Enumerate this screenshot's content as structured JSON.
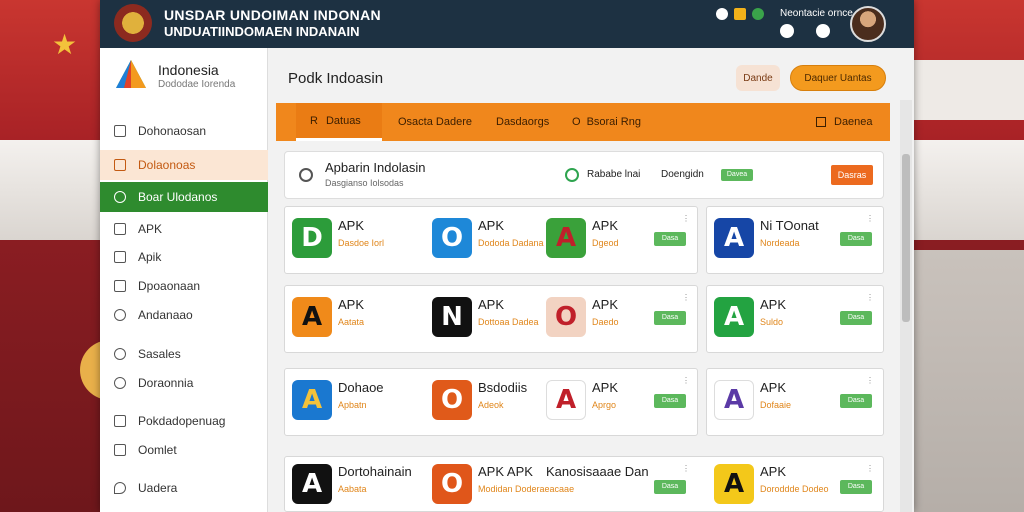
{
  "topbar": {
    "title_line1": "UNSDAR UNDOIMAN INDONAN",
    "title_line2": "UNDUATIINDOMAEN INDANAIN",
    "meta": "Neontacie ornce",
    "icon_names": [
      "record-icon",
      "folder-icon",
      "globe-icon",
      "chat-icon",
      "message-icon"
    ]
  },
  "sidebar": {
    "brand_name": "Indonesia",
    "brand_sub": "Dododae Iorenda",
    "items": [
      {
        "label": "Dohonaosan",
        "icon": "list-icon"
      },
      {
        "label": "Dolaonoas",
        "icon": "flag-icon"
      },
      {
        "label": "Boar Ulodanos",
        "icon": "leaf-icon"
      },
      {
        "label": "APK",
        "icon": "box-icon"
      },
      {
        "label": "Apik",
        "icon": "grid-icon"
      },
      {
        "label": "Dpoaonaan",
        "icon": "doc-icon"
      },
      {
        "label": "Andanaao",
        "icon": "user-icon"
      },
      {
        "label": "Sasales",
        "icon": "gear-icon"
      },
      {
        "label": "Doraonnia",
        "icon": "globe-icon"
      },
      {
        "label": "Pokdadopenuag",
        "icon": "edit-icon"
      },
      {
        "label": "Oomlet",
        "icon": "folder-icon"
      },
      {
        "label": "Uadera",
        "icon": "shield-icon"
      }
    ]
  },
  "main": {
    "page_title": "Podk Indoasin",
    "login_label": "Dande",
    "primary_label": "Daquer Uantas"
  },
  "tabs": [
    {
      "label": "Datuas",
      "prefix": "R"
    },
    {
      "label": "Osacta Dadere",
      "prefix": ""
    },
    {
      "label": "Dasdaorgs",
      "prefix": ""
    },
    {
      "label": "Bsorai Rng",
      "prefix": "O"
    },
    {
      "label": "Daenea",
      "prefix": ""
    }
  ],
  "search": {
    "title": "Apbarin Indolasin",
    "subtitle": "Dasgianso Iolsodas",
    "label1": "Rababe lnai",
    "label2": "Doengidn",
    "tag": "Davea",
    "button": "Dasras"
  },
  "apps": [
    {
      "name": "APK",
      "sub": "Dasdoe Iorl",
      "glyph": "D",
      "bg": "#2c9c3a",
      "fg": "#ffffff"
    },
    {
      "name": "APK",
      "sub": "Dododa Dadana",
      "glyph": "O",
      "bg": "#1e88d8",
      "fg": "#ffffff"
    },
    {
      "name": "APK",
      "sub": "Dgeod",
      "glyph": "A",
      "bg": "#3aa13a",
      "fg": "#c0202a"
    },
    {
      "name": "Ni TOonat",
      "sub": "Nordeada",
      "glyph": "A",
      "bg": "#1646a6",
      "fg": "#ffffff"
    },
    {
      "name": "APK",
      "sub": "Aatata",
      "glyph": "A",
      "bg": "#f08a1a",
      "fg": "#111111"
    },
    {
      "name": "APK",
      "sub": "Dottoaa Dadea",
      "glyph": "N",
      "bg": "#111111",
      "fg": "#ffffff"
    },
    {
      "name": "APK",
      "sub": "Daedo",
      "glyph": "O",
      "bg": "#f2d3c2",
      "fg": "#c0202a"
    },
    {
      "name": "APK",
      "sub": "Suldo",
      "glyph": "A",
      "bg": "#23a341",
      "fg": "#ffffff"
    },
    {
      "name": "Dohaoe",
      "sub": "Apbatn",
      "glyph": "A",
      "bg": "#1a78d0",
      "fg": "#f3c23b"
    },
    {
      "name": "Bsdodiis",
      "sub": "Adeok",
      "glyph": "O",
      "bg": "#e05a1a",
      "fg": "#ffffff"
    },
    {
      "name": "APK",
      "sub": "Aprgo",
      "glyph": "A",
      "bg": "#ffffff",
      "fg": "#c0202a"
    },
    {
      "name": "APK",
      "sub": "Dofaaie",
      "glyph": "A",
      "bg": "#ffffff",
      "fg": "#5b3aa6"
    },
    {
      "name": "Dortohainain",
      "sub": "Aabata",
      "glyph": "A",
      "bg": "#111111",
      "fg": "#ffffff"
    },
    {
      "name": "APK APK",
      "sub": "Modidan Doderaeacaae",
      "glyph": "O",
      "bg": "#e0561a",
      "fg": "#ffffff"
    },
    {
      "name": "Kanosisaaae Dan",
      "sub": "",
      "glyph": "",
      "bg": "#ffffff",
      "fg": "#ffffff"
    },
    {
      "name": "APK",
      "sub": "Doroddde Dodeo",
      "glyph": "A",
      "bg": "#f3c81a",
      "fg": "#111111"
    }
  ],
  "install_label": "Dasa",
  "colors": {
    "accent": "#f0871c",
    "topbar": "#1d3142",
    "green": "#2e8b2e",
    "install": "#5cb85c"
  }
}
